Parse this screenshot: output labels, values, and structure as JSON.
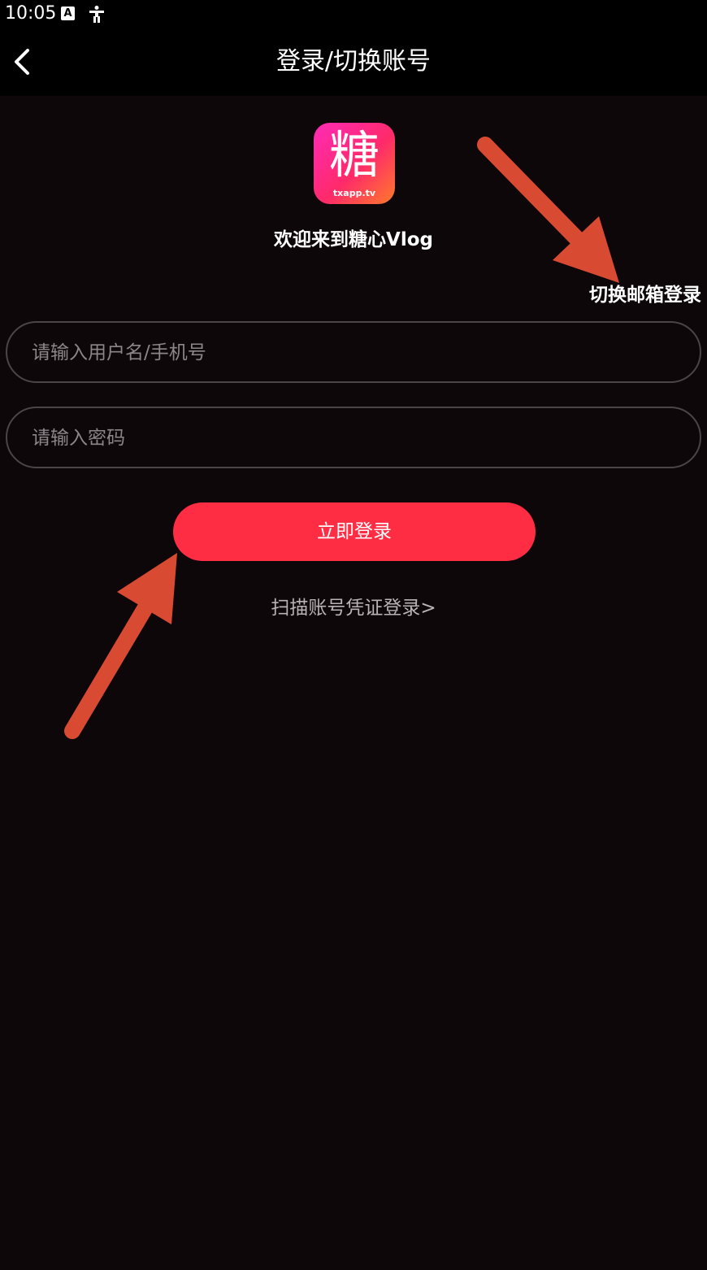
{
  "status_bar": {
    "time": "10:05",
    "icons": [
      "a-badge-icon",
      "accessibility-icon"
    ]
  },
  "header": {
    "title": "登录/切换账号",
    "back_icon": "chevron-left-icon"
  },
  "logo": {
    "char": "糖",
    "subtitle": "txapp.tv"
  },
  "welcome_text": "欢迎来到糖心Vlog",
  "switch_email_label": "切换邮箱登录",
  "form": {
    "username_placeholder": "请输入用户名/手机号",
    "username_value": "",
    "password_placeholder": "请输入密码",
    "password_value": ""
  },
  "login_button_label": "立即登录",
  "scan_login_label": "扫描账号凭证登录>",
  "colors": {
    "background": "#0d070a",
    "accent": "#ff2d44",
    "annotation_arrow": "#d94a33"
  }
}
